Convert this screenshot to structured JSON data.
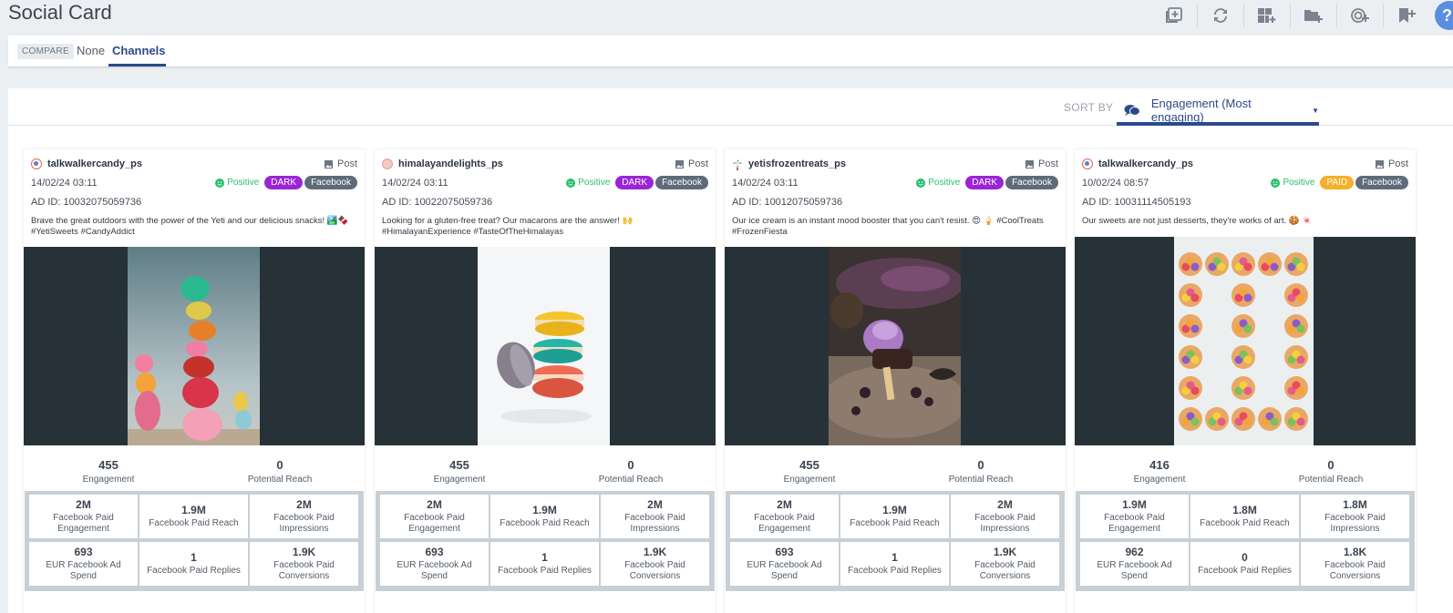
{
  "page": {
    "title": "Social Card"
  },
  "compare": {
    "tag": "COMPARE",
    "options": [
      "None",
      "Channels"
    ],
    "active": "Channels"
  },
  "sort": {
    "label": "SORT BY",
    "value": "Engagement (Most engaging)"
  },
  "colors": {
    "accent": "#2b4a8a",
    "positive": "#27c16b",
    "dark_badge": "#9b25d6",
    "paid_badge": "#f4b02b",
    "facebook_badge": "#5f6b78",
    "media_bg": "#263238"
  },
  "cards": [
    {
      "username": "talkwalkercandy_ps",
      "post_type": "Post",
      "date": "14/02/24 03:11",
      "sentiment": "Positive",
      "ad_badge": "DARK",
      "channel": "Facebook",
      "ad_id": "AD ID: 10032075059736",
      "caption": "Brave the great outdoors with the power of the Yeti and our delicious snacks! 🏞️🍫 #YetiSweets #CandyAddict",
      "engagement": "455",
      "engagement_label": "Engagement",
      "reach": "0",
      "reach_label": "Potential Reach",
      "stats": [
        {
          "value": "2M",
          "label": "Facebook Paid Engagement"
        },
        {
          "value": "1.9M",
          "label": "Facebook Paid Reach"
        },
        {
          "value": "2M",
          "label": "Facebook Paid Impressions"
        },
        {
          "value": "693",
          "label": "EUR Facebook Ad Spend"
        },
        {
          "value": "1",
          "label": "Facebook Paid Replies"
        },
        {
          "value": "1.9K",
          "label": "Facebook Paid Conversions"
        }
      ]
    },
    {
      "username": "himalayandelights_ps",
      "post_type": "Post",
      "date": "14/02/24 03:11",
      "sentiment": "Positive",
      "ad_badge": "DARK",
      "channel": "Facebook",
      "ad_id": "AD ID: 10022075059736",
      "caption": "Looking for a gluten-free treat? Our macarons are the answer! 🙌 #HimalayanExperience #TasteOfTheHimalayas",
      "engagement": "455",
      "engagement_label": "Engagement",
      "reach": "0",
      "reach_label": "Potential Reach",
      "stats": [
        {
          "value": "2M",
          "label": "Facebook Paid Engagement"
        },
        {
          "value": "1.9M",
          "label": "Facebook Paid Reach"
        },
        {
          "value": "2M",
          "label": "Facebook Paid Impressions"
        },
        {
          "value": "693",
          "label": "EUR Facebook Ad Spend"
        },
        {
          "value": "1",
          "label": "Facebook Paid Replies"
        },
        {
          "value": "1.9K",
          "label": "Facebook Paid Conversions"
        }
      ]
    },
    {
      "username": "yetisfrozentreats_ps",
      "post_type": "Post",
      "date": "14/02/24 03:11",
      "sentiment": "Positive",
      "ad_badge": "DARK",
      "channel": "Facebook",
      "ad_id": "AD ID: 10012075059736",
      "caption": "Our ice cream is an instant mood booster that you can't resist. 😍 🍦 #CoolTreats #FrozenFiesta",
      "engagement": "455",
      "engagement_label": "Engagement",
      "reach": "0",
      "reach_label": "Potential Reach",
      "stats": [
        {
          "value": "2M",
          "label": "Facebook Paid Engagement"
        },
        {
          "value": "1.9M",
          "label": "Facebook Paid Reach"
        },
        {
          "value": "2M",
          "label": "Facebook Paid Impressions"
        },
        {
          "value": "693",
          "label": "EUR Facebook Ad Spend"
        },
        {
          "value": "1",
          "label": "Facebook Paid Replies"
        },
        {
          "value": "1.9K",
          "label": "Facebook Paid Conversions"
        }
      ]
    },
    {
      "username": "talkwalkercandy_ps",
      "post_type": "Post",
      "date": "10/02/24 08:57",
      "sentiment": "Positive",
      "ad_badge": "PAID",
      "channel": "Facebook",
      "ad_id": "AD ID: 10031114505193",
      "caption": "Our sweets are not just desserts, they're works of art. 🍪 🍬",
      "engagement": "416",
      "engagement_label": "Engagement",
      "reach": "0",
      "reach_label": "Potential Reach",
      "stats": [
        {
          "value": "1.9M",
          "label": "Facebook Paid Engagement"
        },
        {
          "value": "1.8M",
          "label": "Facebook Paid Reach"
        },
        {
          "value": "1.8M",
          "label": "Facebook Paid Impressions"
        },
        {
          "value": "962",
          "label": "EUR Facebook Ad Spend"
        },
        {
          "value": "0",
          "label": "Facebook Paid Replies"
        },
        {
          "value": "1.8K",
          "label": "Facebook Paid Conversions"
        }
      ]
    }
  ]
}
